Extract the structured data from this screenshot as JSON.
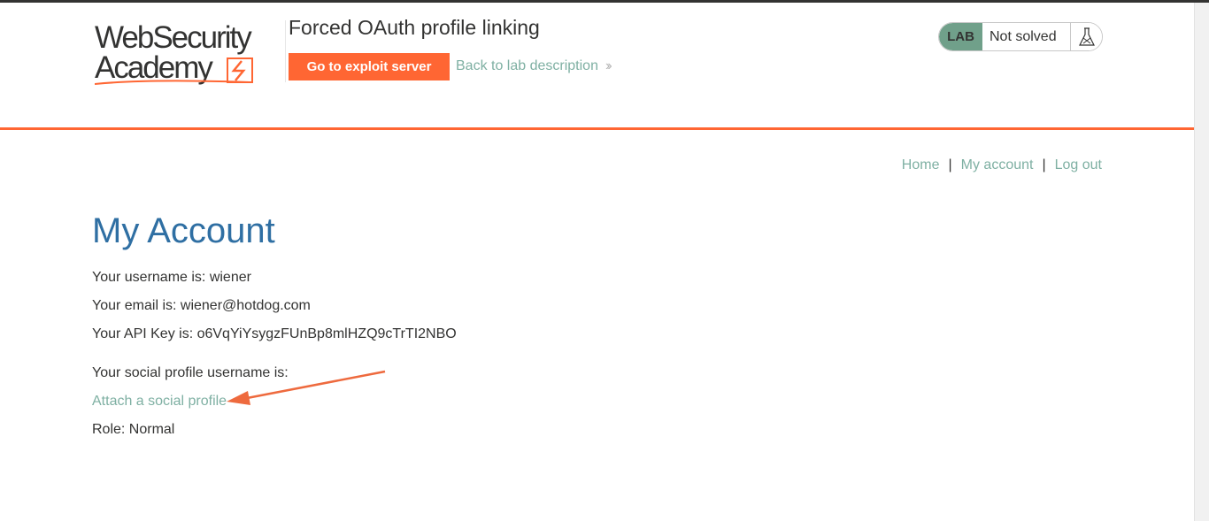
{
  "brand": {
    "line1": "WebSecurity",
    "line2": "Academy",
    "accent_color": "#ff6633",
    "link_color": "#7fb0a3",
    "heading_color": "#2f6fa3"
  },
  "lab": {
    "title": "Forced OAuth profile linking",
    "exploit_button": "Go to exploit server",
    "back_link": "Back to lab description",
    "back_icon": "double-chevron-right-icon"
  },
  "status": {
    "badge": "LAB",
    "text": "Not solved",
    "icon": "flask-icon",
    "badge_color": "#70a08a"
  },
  "nav": {
    "home": "Home",
    "my_account": "My account",
    "logout": "Log out",
    "separator": "|"
  },
  "account": {
    "heading": "My Account",
    "username_line": "Your username is: wiener",
    "email_line": "Your email is: wiener@hotdog.com",
    "api_key_line": "Your API Key is: o6VqYiYsygzFUnBp8mlHZQ9cTrTI2NBO",
    "social_line": "Your social profile username is:",
    "attach_link": "Attach a social profile",
    "role_line": "Role: Normal"
  }
}
